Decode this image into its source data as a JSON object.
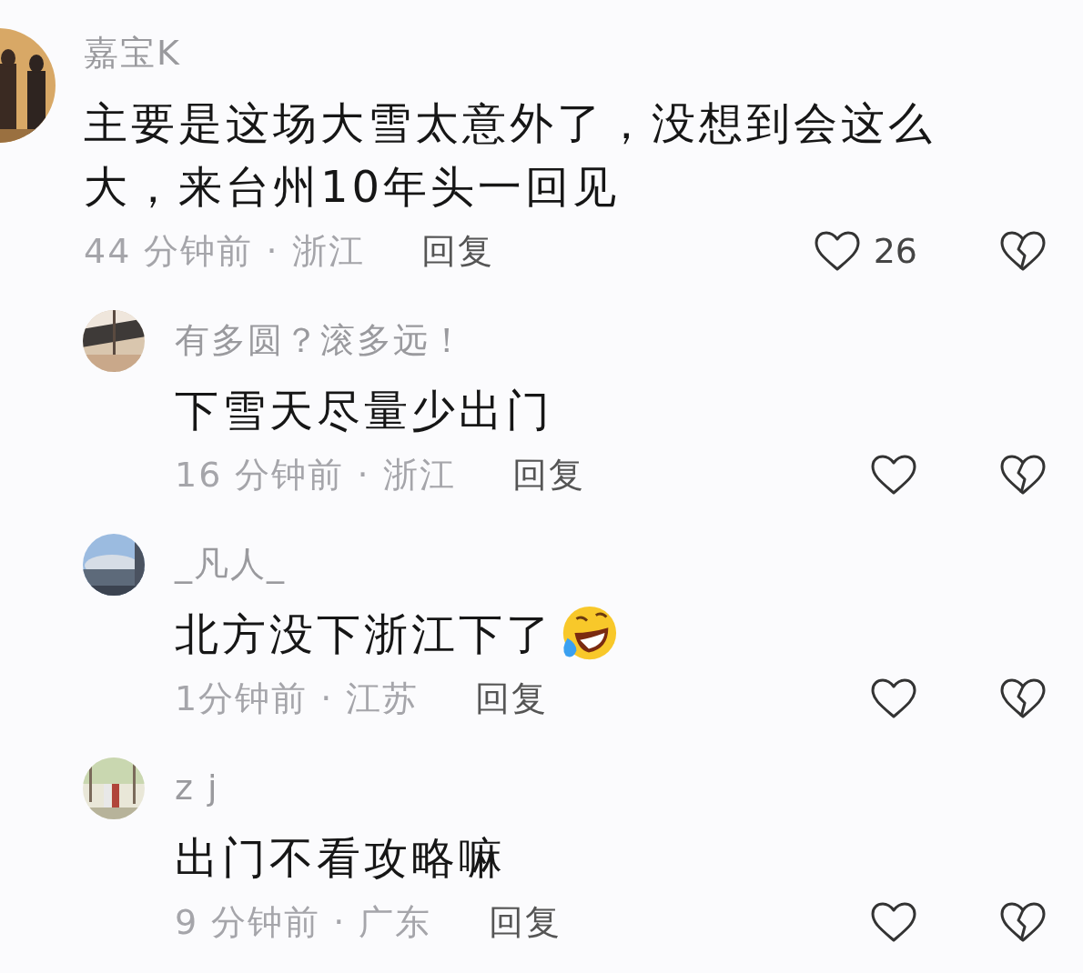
{
  "comment": {
    "username": "嘉宝K",
    "text": "主要是这场大雪太意外了，没想到会这么大，来台州10年头一回见",
    "meta": "44 分钟前 · 浙江",
    "reply": "回复",
    "like_count": "26"
  },
  "replies": [
    {
      "kind": "plain",
      "username": "有多圆？滚多远！",
      "text": "下雪天尽量少出门",
      "meta": "16 分钟前 · 浙江",
      "reply": "回复"
    },
    {
      "kind": "emoji",
      "username": "_凡人_",
      "text": "北方没下浙江下了",
      "meta": "1分钟前 · 江苏",
      "reply": "回复"
    },
    {
      "kind": "plain",
      "username": "z j",
      "text": "出门不看攻略嘛",
      "meta": "9 分钟前 · 广东",
      "reply": "回复"
    }
  ]
}
